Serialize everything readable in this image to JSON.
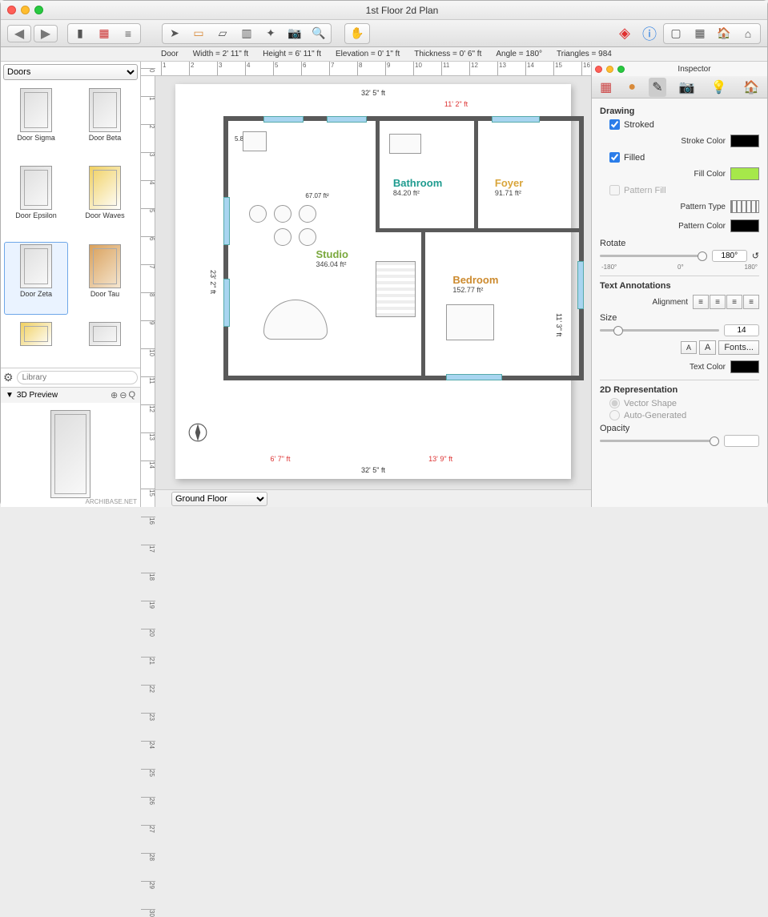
{
  "window": {
    "title": "1st Floor 2d Plan"
  },
  "infobar": {
    "object": "Door",
    "width": "Width = 2' 11\" ft",
    "height": "Height = 6' 11\" ft",
    "elevation": "Elevation = 0' 1\" ft",
    "thickness": "Thickness = 0' 6\" ft",
    "angle": "Angle = 180°",
    "triangles": "Triangles = 984"
  },
  "library": {
    "category": "Doors",
    "search_placeholder": "Library",
    "items": [
      {
        "label": "Door Sigma"
      },
      {
        "label": "Door Beta"
      },
      {
        "label": "Door Epsilon"
      },
      {
        "label": "Door Waves"
      },
      {
        "label": "Door Zeta",
        "selected": true
      },
      {
        "label": "Door Tau"
      }
    ],
    "preview_title": "3D Preview",
    "credit": "ARCHIBASE.NET"
  },
  "canvas": {
    "floor_selector": "Ground Floor",
    "dims": {
      "top_total": "32' 5\" ft",
      "top_right": "11' 2\" ft",
      "left_total": "23' 2\" ft",
      "right_total": "11' 3\" ft",
      "bottom_total": "32' 5\" ft",
      "bottom_left": "6' 7\" ft",
      "bottom_right": "13' 9\" ft",
      "note1": "5.87 ft²",
      "note2": "67.07 ft²"
    },
    "rooms": {
      "bathroom": {
        "name": "Bathroom",
        "area": "84.20 ft²",
        "color": "#1e9b8f"
      },
      "foyer": {
        "name": "Foyer",
        "area": "91.71 ft²",
        "color": "#d9a53b"
      },
      "studio": {
        "name": "Studio",
        "area": "346.04 ft²",
        "color": "#7aa83c"
      },
      "bedroom": {
        "name": "Bedroom",
        "area": "152.77 ft²",
        "color": "#cc8a2e"
      }
    }
  },
  "inspector": {
    "title": "Inspector",
    "drawing": {
      "heading": "Drawing",
      "stroked": "Stroked",
      "stroke_color": "Stroke Color",
      "filled": "Filled",
      "fill_color": "Fill Color",
      "pattern_fill": "Pattern Fill",
      "pattern_type": "Pattern Type",
      "pattern_color": "Pattern Color",
      "rotate": "Rotate",
      "rotate_value": "180°",
      "ticks": [
        "-180°",
        "0°",
        "180°"
      ],
      "reset_icon": "↺"
    },
    "text": {
      "heading": "Text Annotations",
      "alignment": "Alignment",
      "size": "Size",
      "size_value": "14",
      "fonts": "Fonts...",
      "text_color": "Text Color"
    },
    "rep2d": {
      "heading": "2D Representation",
      "vector": "Vector Shape",
      "auto": "Auto-Generated",
      "opacity": "Opacity"
    }
  }
}
